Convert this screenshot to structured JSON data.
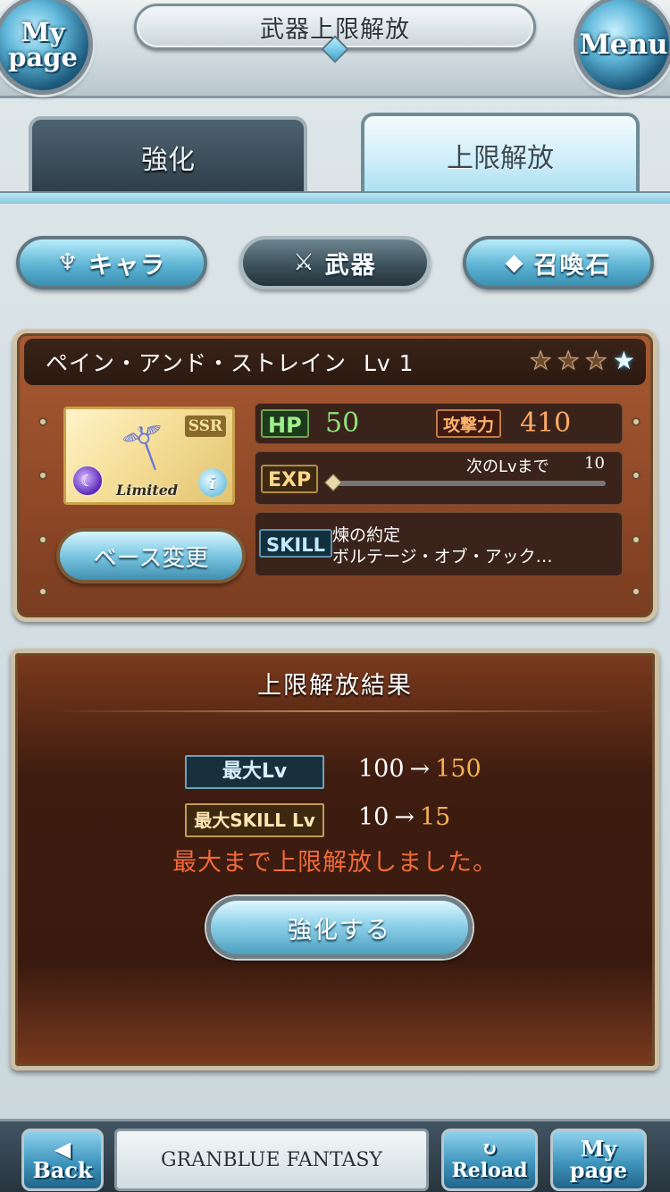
{
  "header": {
    "title": "武器上限解放",
    "mypage_label": "My\npage",
    "menu_label": "Menu"
  },
  "tabs": [
    {
      "label": "強化",
      "active": false
    },
    {
      "label": "上限解放",
      "active": true
    }
  ],
  "categories": [
    {
      "label": "キャラ",
      "icon": "chara-emblem-icon",
      "active": false
    },
    {
      "label": "武器",
      "icon": "crossed-swords-icon",
      "active": true
    },
    {
      "label": "召喚石",
      "icon": "crystal-icon",
      "active": false
    }
  ],
  "weapon": {
    "name": "ペイン・アンド・ストレイン",
    "level": "Lv 1",
    "stars_total": 4,
    "stars_filled": 1,
    "rarity": "SSR",
    "limited_label": "Limited",
    "base_change_label": "ベース変更",
    "hp_label": "HP",
    "hp": "50",
    "atk_label": "攻撃力",
    "atk": "410",
    "exp_label": "EXP",
    "next_lv_label": "次のLvまで",
    "next_lv_value": "10",
    "exp_progress": 0,
    "skill_label": "SKILL",
    "skill_1": "煉の約定",
    "skill_2": "ボルテージ・オブ・アック…"
  },
  "result": {
    "title": "上限解放結果",
    "max_lv_label": "最大Lv",
    "max_lv_from": "100",
    "max_lv_arrow": "→",
    "max_lv_to": "150",
    "max_skill_label": "最大SKILL Lv",
    "max_skill_from": "10",
    "max_skill_arrow": "→",
    "max_skill_to": "15",
    "message": "最大まで上限解放しました。",
    "enhance_button": "強化する"
  },
  "footer": {
    "back": "◀\nBack",
    "logo": "GRANBLUE FANTASY",
    "reload": "↻\nReload",
    "mypage": "My\npage"
  },
  "colors": {
    "accent_blue": "#5fb5d5",
    "panel_brown": "#8e4827",
    "hp_green": "#8ee07a",
    "atk_orange": "#ffab66",
    "message_red": "#f06b3a"
  }
}
